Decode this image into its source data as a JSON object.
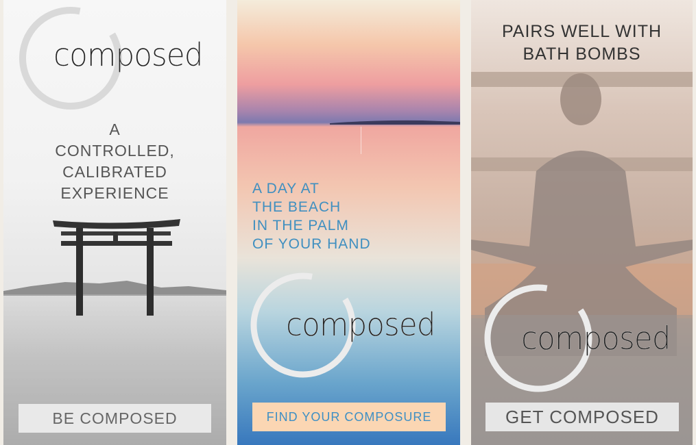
{
  "brand": "composed",
  "banners": [
    {
      "headline": [
        "A",
        "CONTROLLED,",
        "CALIBRATED",
        "EXPERIENCE"
      ],
      "cta": "BE COMPOSED",
      "accent": "#555555"
    },
    {
      "headline": [
        "A DAY AT",
        "THE BEACH",
        "IN THE PALM",
        "OF YOUR HAND"
      ],
      "cta": "FIND YOUR COMPOSURE",
      "accent": "#3f8fc0",
      "cta_bg": "#fbd6b3"
    },
    {
      "headline": [
        "PAIRS WELL WITH",
        "BATH BOMBS"
      ],
      "cta": "GET COMPOSED",
      "accent": "#333333"
    }
  ]
}
